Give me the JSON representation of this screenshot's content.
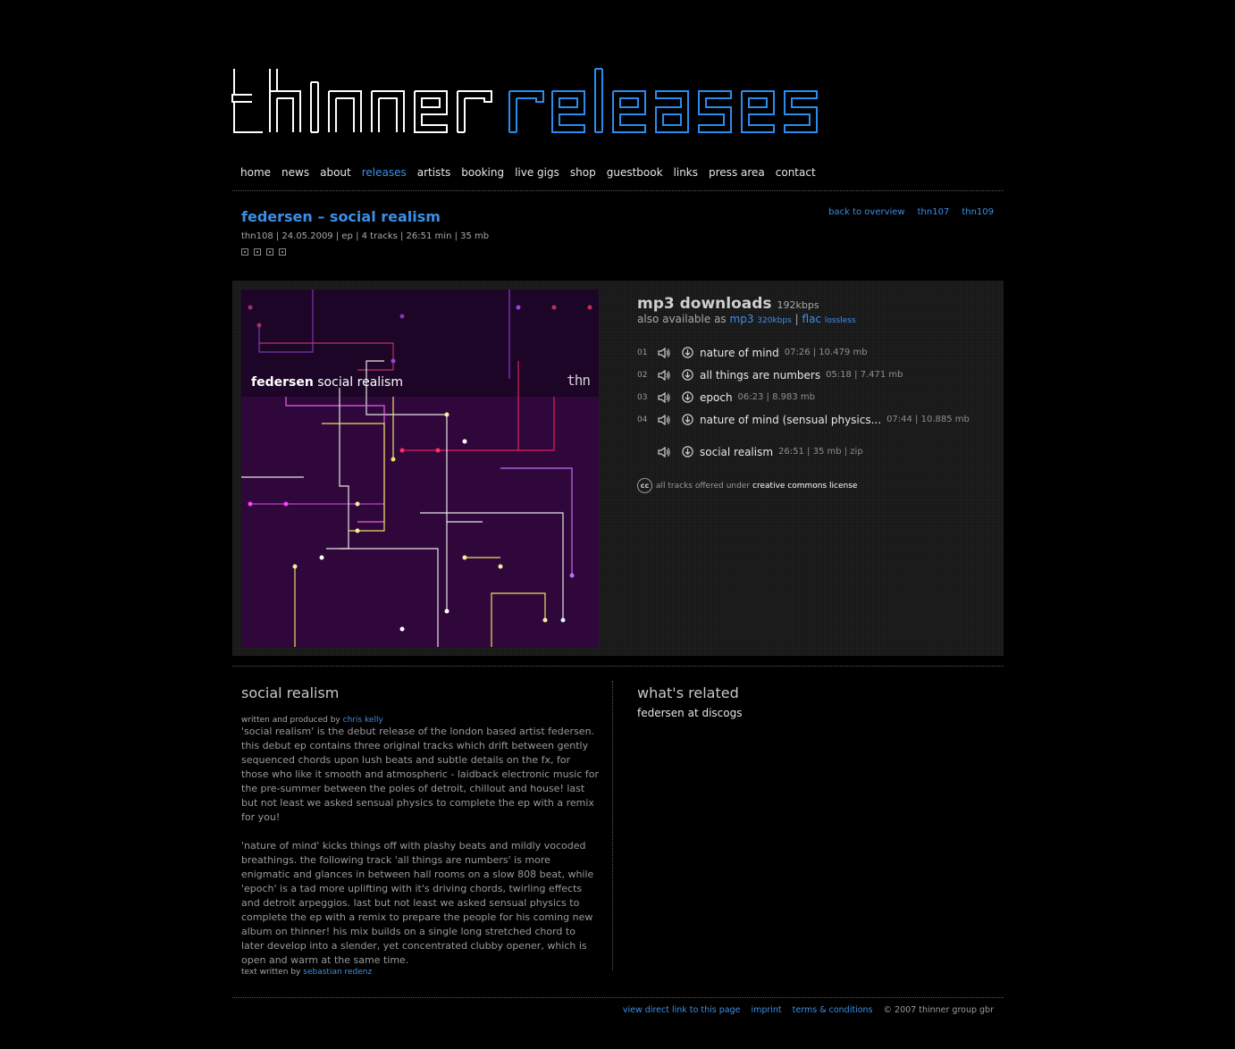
{
  "site": {
    "logo_word1": "thinner",
    "logo_word2": "releases",
    "colors": {
      "background": "#000000",
      "accent": "#3a8fe8",
      "cover": "#30073b"
    }
  },
  "nav": [
    "home",
    "news",
    "about",
    "releases",
    "artists",
    "booking",
    "live gigs",
    "shop",
    "guestbook",
    "links",
    "press area",
    "contact"
  ],
  "nav_active": "releases",
  "release": {
    "title": "federsen – social realism",
    "meta": "thn108 | 24.05.2009 | ep | 4 tracks | 26:51 min | 35 mb",
    "view_icons": [
      "view-small-icon",
      "view-grid-icon",
      "view-dots-icon",
      "view-large-icon"
    ],
    "top_links": {
      "back": "back to overview",
      "prev": "thn107",
      "next": "thn109"
    }
  },
  "cover": {
    "artist": "federsen",
    "title": "social realism",
    "label_mark": "thn"
  },
  "downloads": {
    "heading": "mp3 downloads",
    "bitrate": "192kbps",
    "also_prefix": "also available as",
    "mp3": "mp3",
    "mp3_rate": "320kbps",
    "sep": "|",
    "flac": "flac",
    "flac_note": "lossless",
    "tracks": [
      {
        "num": "01",
        "name": "nature of mind",
        "info": "07:26 | 10.479 mb"
      },
      {
        "num": "02",
        "name": "all things are numbers",
        "info": "05:18 | 7.471 mb"
      },
      {
        "num": "03",
        "name": "epoch",
        "info": "06:23 | 8.983 mb"
      },
      {
        "num": "04",
        "name": "nature of mind (sensual physics...",
        "info": "07:44 | 10.885 mb"
      }
    ],
    "total": {
      "name": "social realism",
      "info": "26:51 | 35 mb | zip"
    },
    "license_prefix": "all tracks offered under",
    "license_link": "creative commons license",
    "cc_label": "cc"
  },
  "about": {
    "heading": "social realism",
    "credit_prefix": "written and produced by",
    "credit_name": "chris kelly",
    "para1": "'social realism' is the debut release of the london based artist federsen. this debut ep contains three original tracks which drift between gently sequenced chords upon lush beats and subtle details on the fx, for those who like it smooth and atmospheric - laidback electronic music for the pre-summer between the poles of detroit, chillout and house! last but not least we asked sensual physics to complete the ep with a remix for you!",
    "para2": "'nature of mind' kicks things off with plashy beats and mildly vocoded breathings. the following track 'all things are numbers' is more enigmatic and glances in between hall rooms on a slow 808 beat, while 'epoch' is a tad more uplifting with it's driving chords, twirling effects and detroit arpeggios. last but not least we asked sensual physics to complete the ep with a remix to prepare the people for his coming new album on thinner! his mix builds on a single long stretched chord to later develop into a slender, yet concentrated clubby opener, which is open and warm at the same time.",
    "text_by_prefix": "text written by",
    "text_by_name": "sebastian redenz"
  },
  "related": {
    "heading": "what's related",
    "items": [
      "federsen at discogs"
    ]
  },
  "footer": {
    "direct_link": "view direct link to this page",
    "imprint": "imprint",
    "terms": "terms & conditions",
    "copyright": "© 2007 thinner group gbr"
  }
}
